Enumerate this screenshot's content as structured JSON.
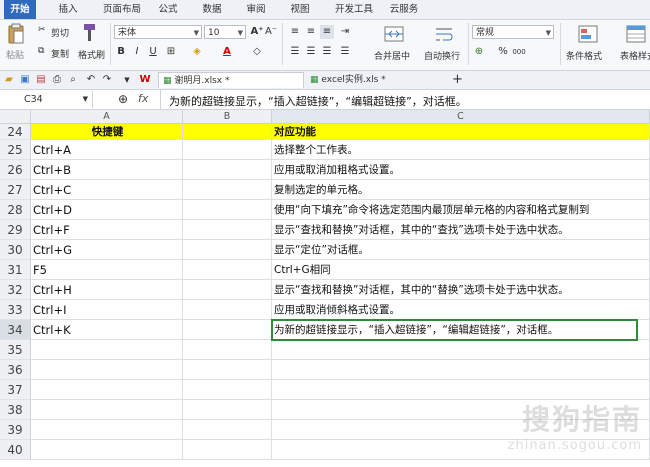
{
  "menu": {
    "tabs": [
      "开始",
      "插入",
      "页面布局",
      "公式",
      "数据",
      "审阅",
      "视图",
      "开发工具",
      "云服务"
    ],
    "active": "开始"
  },
  "ribbon": {
    "paste": "粘贴",
    "cut": "剪切",
    "copy": "复制",
    "format_painter": "格式刷",
    "font_name": "宋体",
    "font_size": "10",
    "merge_center": "合并居中",
    "wrap_text": "自动换行",
    "number_format": "常规",
    "conditional_format": "条件格式",
    "table_style": "表格样式",
    "bold": "B",
    "italic": "I",
    "underline": "U",
    "font_grow": "A⁺",
    "font_shrink": "A⁻",
    "percent": "%",
    "thousands": "000"
  },
  "doc_tabs": [
    {
      "label": "谢明月.xlsx *",
      "active": true
    },
    {
      "label": "excel实例.xls *",
      "active": false
    }
  ],
  "new_tab": "+",
  "formula_bar": {
    "cell_ref": "C34",
    "fx": "fx",
    "content": "为新的超链接显示，“插入超链接”，“编辑超链接”，对话框。"
  },
  "grid": {
    "columns": [
      "A",
      "B",
      "C"
    ],
    "rows": [
      {
        "num": "24",
        "a": "快捷键",
        "c": "对应功能",
        "header": true
      },
      {
        "num": "25",
        "a": "Ctrl+A",
        "c": "选择整个工作表。"
      },
      {
        "num": "26",
        "a": "Ctrl+B",
        "c": "应用或取消加粗格式设置。"
      },
      {
        "num": "27",
        "a": "Ctrl+C",
        "c": "复制选定的单元格。"
      },
      {
        "num": "28",
        "a": "Ctrl+D",
        "c": "使用“向下填充”命令将选定范围内最顶层单元格的内容和格式复制到"
      },
      {
        "num": "29",
        "a": "Ctrl+F",
        "c": "显示“查找和替换”对话框，其中的“查找”选项卡处于选中状态。"
      },
      {
        "num": "30",
        "a": "Ctrl+G",
        "c": "显示“定位”对话框。"
      },
      {
        "num": "31",
        "a": "F5",
        "c": "Ctrl+G相同"
      },
      {
        "num": "32",
        "a": "Ctrl+H",
        "c": "显示“查找和替换”对话框，其中的“替换”选项卡处于选中状态。"
      },
      {
        "num": "33",
        "a": "Ctrl+I",
        "c": "应用或取消倾斜格式设置。"
      },
      {
        "num": "34",
        "a": "Ctrl+K",
        "c": "为新的超链接显示，“插入超链接”，“编辑超链接”，对话框。",
        "selected": true
      },
      {
        "num": "35",
        "a": "",
        "c": ""
      },
      {
        "num": "36",
        "a": "",
        "c": ""
      },
      {
        "num": "37",
        "a": "",
        "c": ""
      },
      {
        "num": "38",
        "a": "",
        "c": ""
      },
      {
        "num": "39",
        "a": "",
        "c": ""
      },
      {
        "num": "40",
        "a": "",
        "c": ""
      }
    ]
  },
  "watermark": {
    "title": "搜狗指南",
    "url": "zhinan.sogou.com"
  },
  "colors": {
    "accent": "#2e6bbf",
    "header_fill": "#ffff00",
    "selection": "#2f8a3a"
  }
}
